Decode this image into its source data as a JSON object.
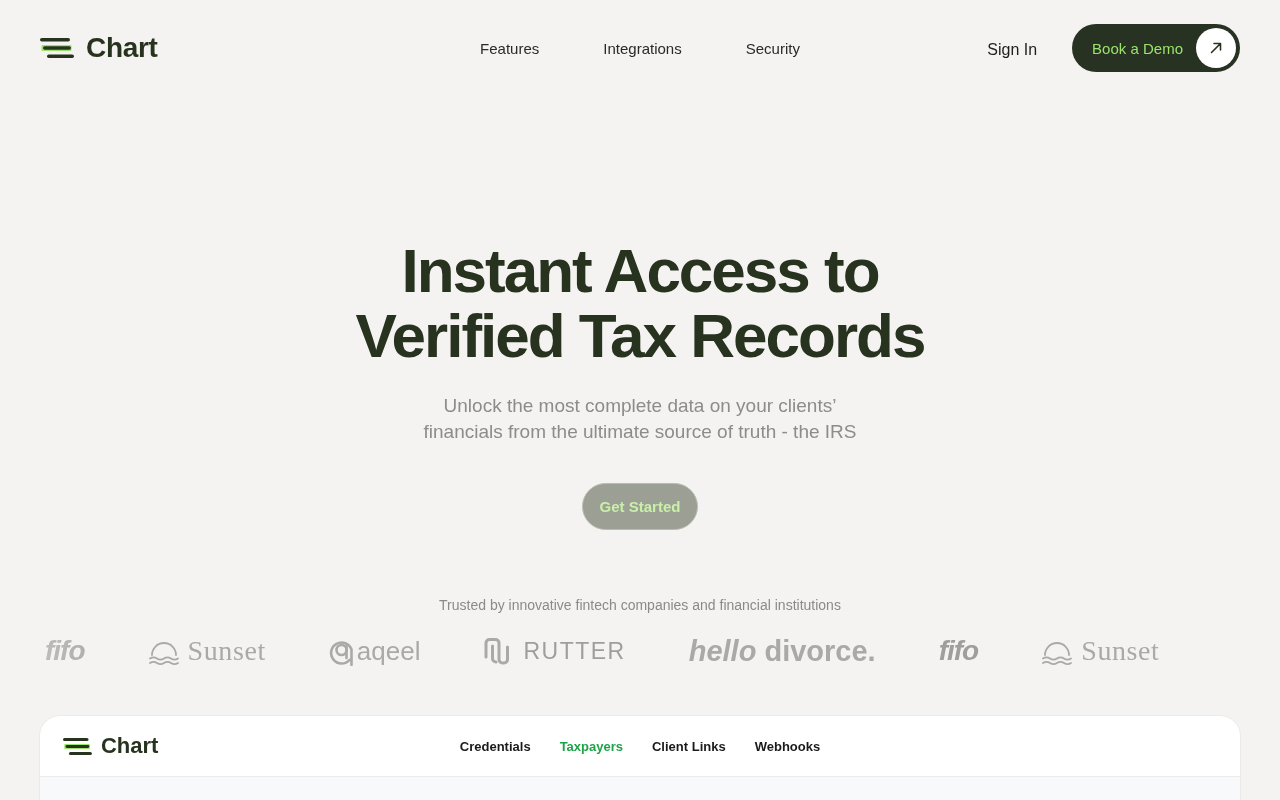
{
  "header": {
    "brand": "Chart",
    "nav": [
      "Features",
      "Integrations",
      "Security"
    ],
    "sign_in": "Sign In",
    "cta": "Book a Demo"
  },
  "hero": {
    "title": "Instant Access to Verified Tax Records",
    "subtitle": "Unlock the most complete data on your clients’ financials from the ultimate source of truth - the IRS",
    "button": "Get Started"
  },
  "trusted": {
    "caption": "Trusted by innovative fintech companies and financial institutions",
    "logos": [
      {
        "kind": "fifo",
        "text": "fifo"
      },
      {
        "kind": "sunset",
        "text": "Sunset"
      },
      {
        "kind": "aqeel",
        "text": "aqeel"
      },
      {
        "kind": "rutter",
        "text": "RUTTER"
      },
      {
        "kind": "hellodivorce",
        "text": "*hello* divorce."
      },
      {
        "kind": "fifo",
        "text": "fifo"
      },
      {
        "kind": "sunset",
        "text": "Sunset"
      }
    ]
  },
  "dashboard": {
    "brand": "Chart",
    "tabs": [
      {
        "label": "Credentials",
        "selected": false
      },
      {
        "label": "Taxpayers",
        "selected": true
      },
      {
        "label": "Client Links",
        "selected": false
      },
      {
        "label": "Webhooks",
        "selected": false
      }
    ]
  }
}
